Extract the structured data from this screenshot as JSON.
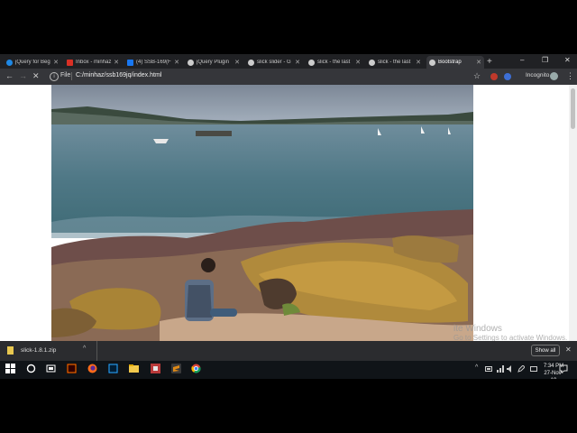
{
  "browser": {
    "tabs": [
      {
        "title": "jQuery for Beg",
        "favicon_color": "#1e88e5",
        "active": false
      },
      {
        "title": "Inbox - minhaz",
        "favicon_color": "#d93025",
        "active": false
      },
      {
        "title": "(4) SSB-169(F",
        "favicon_color": "#1877f2",
        "active": false
      },
      {
        "title": "jQuery Plugin",
        "favicon_color": "#cccccc",
        "active": false
      },
      {
        "title": "slick slider - G",
        "favicon_color": "#cccccc",
        "active": false
      },
      {
        "title": "slick - the last",
        "favicon_color": "#cccccc",
        "active": false
      },
      {
        "title": "slick - the last",
        "favicon_color": "#cccccc",
        "active": false
      },
      {
        "title": "Bootstrap",
        "favicon_color": "#cccccc",
        "active": true
      }
    ],
    "new_tab_glyph": "+",
    "window_controls": {
      "minimize": "–",
      "maximize": "❐",
      "close": "✕"
    },
    "toolbar": {
      "back": "←",
      "forward": "→",
      "stop": "✕",
      "info": "i",
      "scheme": "File",
      "url": "C:/minhaz/ssb169jq/index.html",
      "star": "☆",
      "incognito_label": "Incognito",
      "menu": "⋮"
    }
  },
  "page": {
    "image_alt": "Rocky harbour shoreline with a man seated on the rocks",
    "watermark_line1": "ite Windows",
    "watermark_line2": "Go to Settings to activate Windows."
  },
  "downloads": {
    "file_name": "slick-1.8.1.zip",
    "chevron": "^",
    "show_all": "Show all",
    "close": "✕"
  },
  "taskbar": {
    "time": "7:34 PM",
    "date": "27-Nov-19",
    "tray_chevron": "^",
    "apps": [
      {
        "name": "start-icon",
        "color": "#ffffff"
      },
      {
        "name": "cortana-icon",
        "color": "#ffffff"
      },
      {
        "name": "task-view-icon",
        "color": "#ffffff"
      },
      {
        "name": "illustrator-icon",
        "color": "#ff7c00"
      },
      {
        "name": "firefox-icon",
        "color": "#ff6b1a"
      },
      {
        "name": "photoshop-icon",
        "color": "#31a8ff"
      },
      {
        "name": "file-explorer-icon",
        "color": "#f2c94c"
      },
      {
        "name": "app-icon",
        "color": "#b83a3a"
      },
      {
        "name": "sublime-icon",
        "color": "#e08a16"
      },
      {
        "name": "chrome-icon",
        "color": "#4caf50"
      }
    ]
  },
  "colors": {
    "accent": "#76b9ed",
    "download_file": "#e8c74f"
  }
}
